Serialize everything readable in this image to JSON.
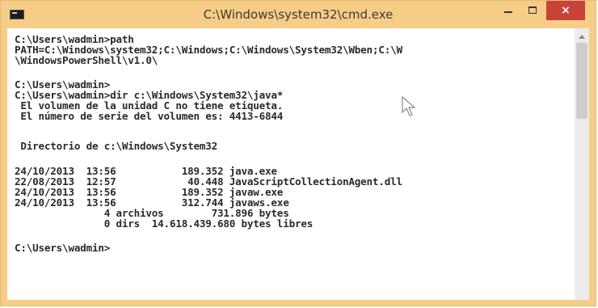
{
  "window": {
    "title": "C:\\Windows\\system32\\cmd.exe",
    "icon": "cmd-icon",
    "controls": {
      "minimize": "minimize-icon",
      "maximize": "maximize-icon",
      "close": "×"
    },
    "colors": {
      "frame": "#f6cd86",
      "close_button": "#c7433a",
      "console_bg": "#ffffff",
      "console_text": "#2a2a2a"
    }
  },
  "console": {
    "lines": [
      "C:\\Users\\wadmin>path",
      "PATH=C:\\Windows\\system32;C:\\Windows;C:\\Windows\\System32\\Wben;C:\\W",
      "\\WindowsPowerShell\\v1.0\\",
      "",
      "C:\\Users\\wadmin>",
      "C:\\Users\\wadmin>dir c:\\Windows\\System32\\java*",
      " El volumen de la unidad C no tiene etiqueta.",
      " El número de serie del volumen es: 4413-6844",
      "",
      " Directorio de c:\\Windows\\System32",
      "",
      "24/10/2013  13:56           189.352 java.exe",
      "22/08/2013  12:57            40.448 JavaScriptCollectionAgent.dll",
      "24/10/2013  13:56           189.352 javaw.exe",
      "24/10/2013  13:56           312.744 javaws.exe",
      "               4 archivos        731.896 bytes",
      "               0 dirs  14.618.439.680 bytes libres",
      "",
      "C:\\Users\\wadmin>"
    ]
  }
}
